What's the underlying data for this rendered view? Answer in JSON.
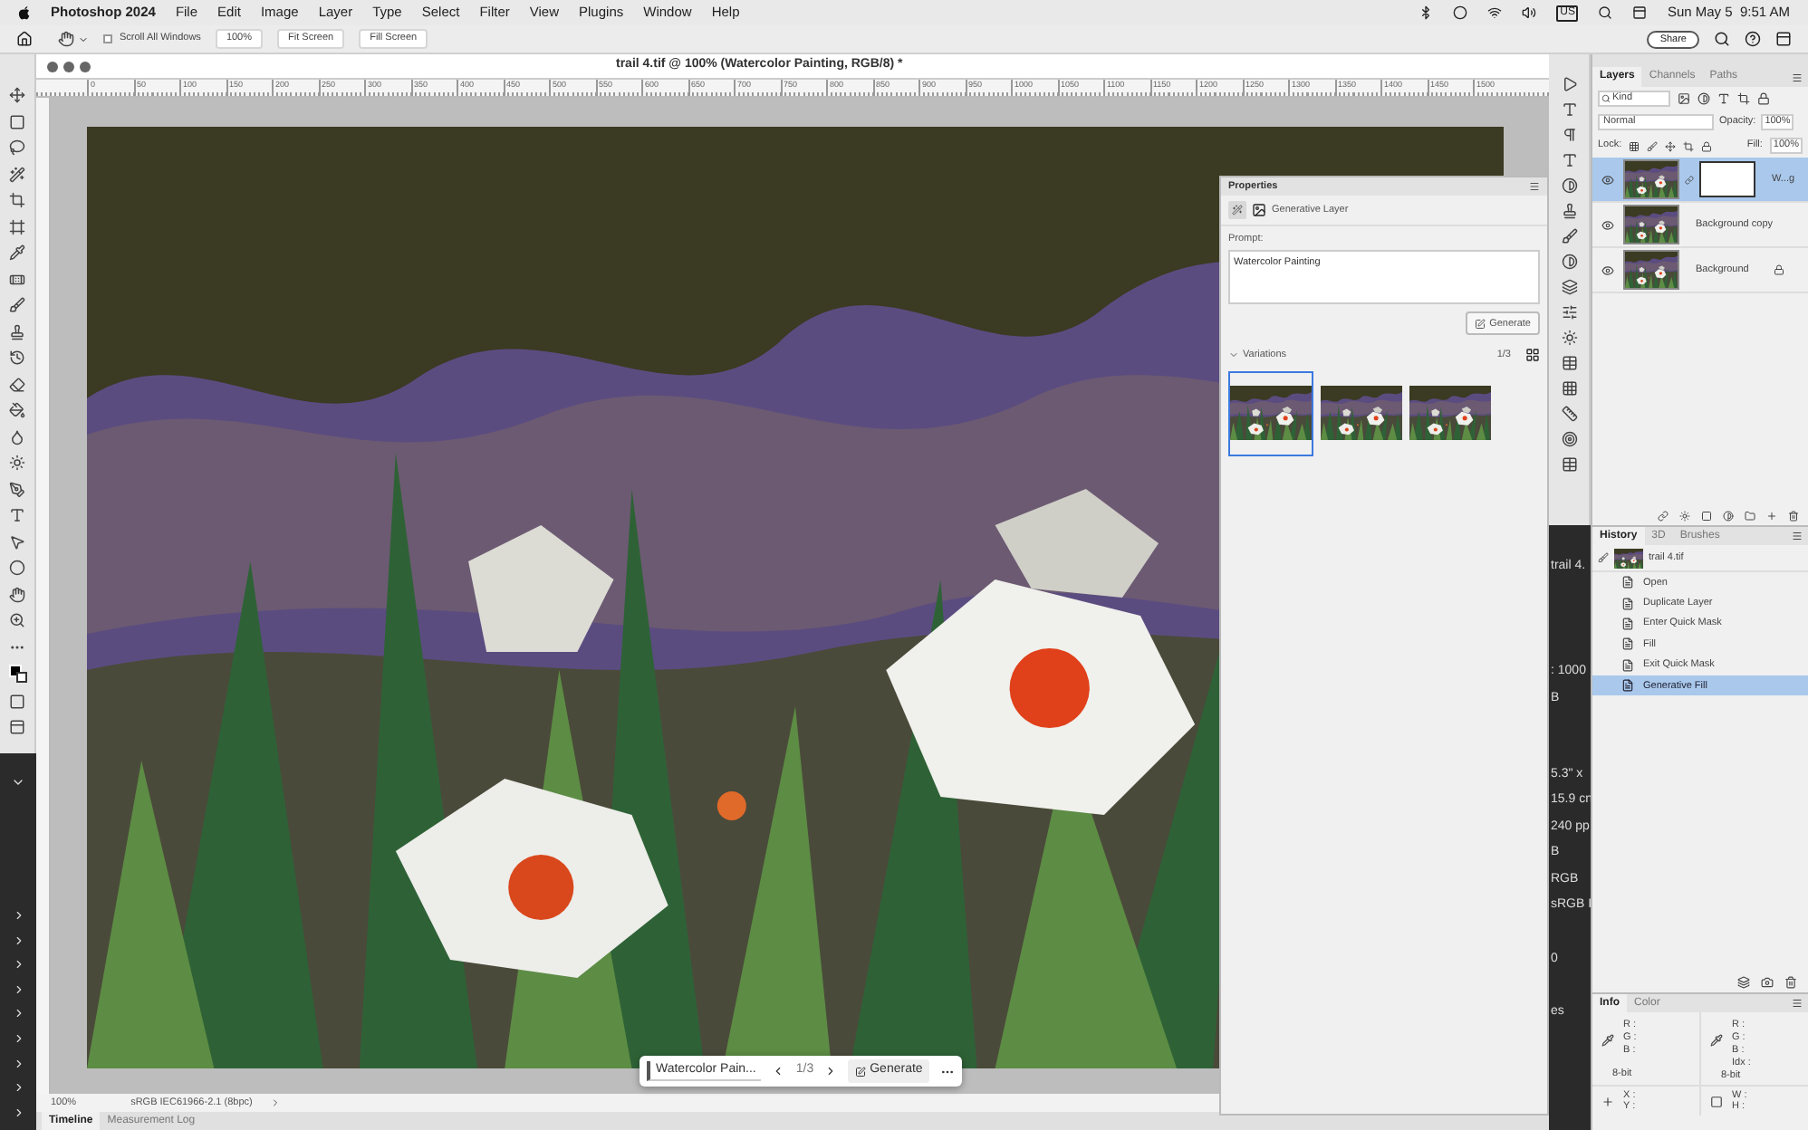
{
  "menu_bar": {
    "app": "Photoshop 2024",
    "items": [
      "File",
      "Edit",
      "Image",
      "Layer",
      "Type",
      "Select",
      "Filter",
      "View",
      "Plugins",
      "Window",
      "Help"
    ],
    "keyboard": "US",
    "clock": "Sun May 5  9:51 AM"
  },
  "options_bar": {
    "scroll_all": {
      "label": "Scroll All Windows",
      "checked": false
    },
    "buttons": [
      "100%",
      "Fit Screen",
      "Fill Screen"
    ],
    "share": "Share"
  },
  "document": {
    "title": "trail 4.tif @ 100% (Watercolor Painting, RGB/8) *",
    "ruler": [
      "0",
      "50",
      "100",
      "150",
      "200",
      "250",
      "300",
      "350",
      "400",
      "450",
      "500",
      "550",
      "600",
      "650",
      "700",
      "750",
      "800",
      "850",
      "900",
      "950",
      "1000",
      "1050",
      "1100",
      "1150",
      "1200",
      "1250",
      "1300",
      "1350",
      "1400",
      "1450",
      "1500"
    ],
    "zoom": "100%",
    "profile": "sRGB IEC61966-2.1 (8bpc)"
  },
  "taskbar": {
    "prompt": "Watercolor Pain...",
    "page": "1/3",
    "generate": "Generate"
  },
  "properties": {
    "title": "Properties",
    "layer_type": "Generative Layer",
    "prompt_label": "Prompt:",
    "prompt": "Watercolor Painting",
    "generate": "Generate",
    "variations_label": "Variations",
    "count": "1/3",
    "variations": [
      {
        "selected": true
      },
      {
        "selected": false
      },
      {
        "selected": false
      }
    ]
  },
  "hidden_panel": [
    "trail 4.",
    ": 1000",
    "B",
    "5.3\" x",
    "15.9 cn",
    "240 pp",
    "B",
    "RGB",
    "sRGB I",
    "0",
    "es"
  ],
  "layers_panel": {
    "tabs": [
      {
        "label": "Layers",
        "selected": true
      },
      {
        "label": "Channels",
        "selected": false
      },
      {
        "label": "Paths",
        "selected": false
      }
    ],
    "filter": "Kind",
    "blend": "Normal",
    "opacity_label": "Opacity:",
    "opacity": "100%",
    "lock_label": "Lock:",
    "fill_label": "Fill:",
    "fill": "100%",
    "layers": [
      {
        "name": "W...g",
        "selected": true,
        "kind": "generative"
      },
      {
        "name": "Background copy",
        "selected": false,
        "kind": "plain"
      },
      {
        "name": "Background",
        "selected": false,
        "kind": "locked"
      }
    ]
  },
  "history_panel": {
    "tabs": [
      {
        "label": "History",
        "selected": true
      },
      {
        "label": "3D",
        "selected": false
      },
      {
        "label": "Brushes",
        "selected": false
      }
    ],
    "snapshot": "trail 4.tif",
    "steps": [
      {
        "label": "Open",
        "selected": false
      },
      {
        "label": "Duplicate Layer",
        "selected": false
      },
      {
        "label": "Enter Quick Mask",
        "selected": false
      },
      {
        "label": "Fill",
        "selected": false
      },
      {
        "label": "Exit Quick Mask",
        "selected": false
      },
      {
        "label": "Generative Fill",
        "selected": true
      }
    ]
  },
  "info_panel": {
    "tabs": [
      {
        "label": "Info",
        "selected": true
      },
      {
        "label": "Color",
        "selected": false
      }
    ],
    "left": [
      "R :",
      "G :",
      "B :"
    ],
    "left_bits": "8-bit",
    "right": [
      "R :",
      "G :",
      "B :",
      "Idx :"
    ],
    "right_bits": "8-bit",
    "xy": [
      "X :",
      "Y :"
    ],
    "wh": [
      "W :",
      "H :"
    ]
  },
  "bottom_tabs": [
    {
      "label": "Timeline",
      "selected": true
    },
    {
      "label": "Measurement Log",
      "selected": false
    }
  ]
}
